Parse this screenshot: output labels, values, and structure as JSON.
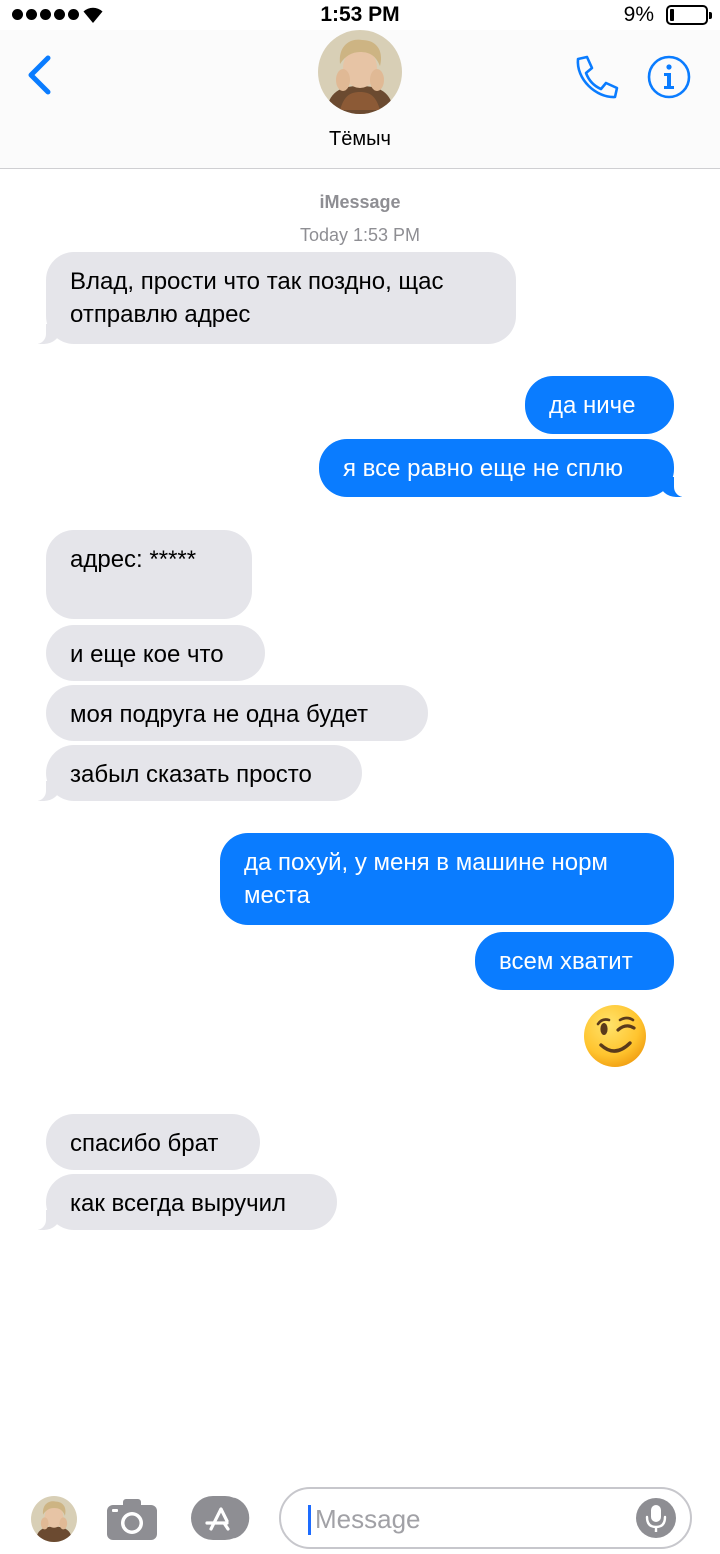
{
  "status_bar": {
    "time": "1:53 PM",
    "battery": "9%"
  },
  "header": {
    "contact_name": "Тёмыч"
  },
  "thread": {
    "service": "iMessage",
    "timestamp": "Today 1:53 PM",
    "messages": [
      {
        "direction": "incoming",
        "text": "Влад, прости что так поздно, щас\nотправлю адрес"
      },
      {
        "direction": "outgoing",
        "text": "да ниче"
      },
      {
        "direction": "outgoing",
        "text": "я все равно еще не сплю"
      },
      {
        "direction": "incoming",
        "text": "адрес: *****"
      },
      {
        "direction": "incoming",
        "text": "и еще кое что"
      },
      {
        "direction": "incoming",
        "text": "моя подруга не одна будет"
      },
      {
        "direction": "incoming",
        "text": "забыл сказать просто"
      },
      {
        "direction": "outgoing",
        "text": "да похуй, у меня в машине норм\nместа"
      },
      {
        "direction": "outgoing",
        "text": "всем хватит"
      },
      {
        "direction": "outgoing",
        "emoji": "winking-face"
      },
      {
        "direction": "incoming",
        "text": "спасибо брат"
      },
      {
        "direction": "incoming",
        "text": "как всегда выручил"
      }
    ]
  },
  "input_bar": {
    "placeholder": "Message"
  },
  "icons": {
    "back": "chevron-left-icon",
    "call": "phone-icon",
    "info": "info-icon",
    "camera": "camera-icon",
    "apps": "app-store-icon",
    "mic": "microphone-icon"
  },
  "colors": {
    "accent": "#0a7cff",
    "incoming_bubble": "#e5e5ea",
    "meta_text": "#8e8e93"
  }
}
